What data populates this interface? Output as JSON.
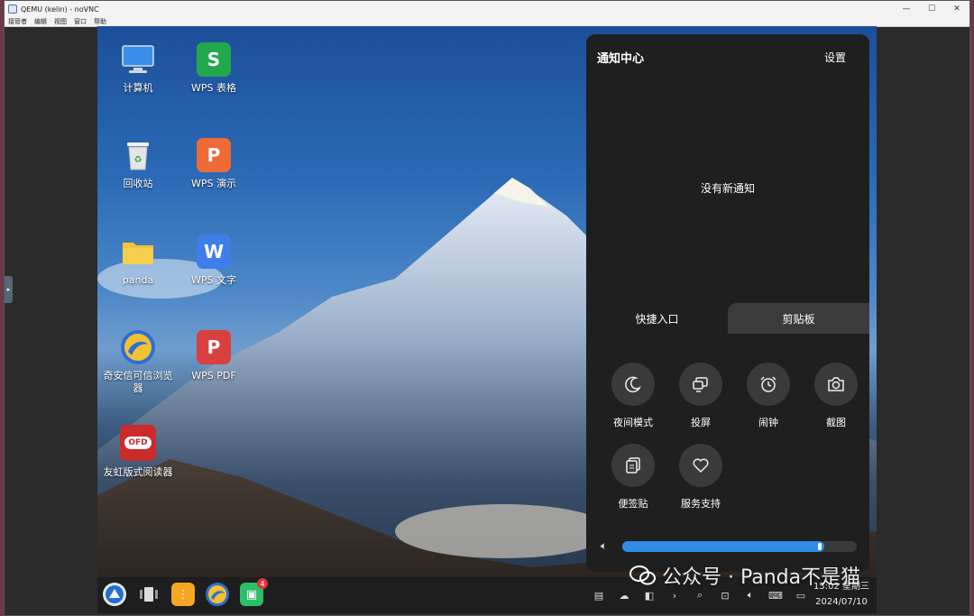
{
  "host": {
    "title": "QEMU (kelin) - noVNC",
    "menu": [
      "接管者",
      "编辑",
      "视图",
      "窗口",
      "帮助"
    ],
    "controls": [
      "—",
      "☐",
      "✕"
    ]
  },
  "desktop": {
    "icons": [
      {
        "name": "computer",
        "label": "计算机",
        "glyph": "monitor-icon",
        "color": "#3a8ee8"
      },
      {
        "name": "wps-sheets",
        "label": "WPS 表格",
        "glyph": "S",
        "color": "#22a84a"
      },
      {
        "name": "recycle-bin",
        "label": "回收站",
        "glyph": "trash-icon",
        "color": "#e9e9e9"
      },
      {
        "name": "wps-presentation",
        "label": "WPS 演示",
        "glyph": "P",
        "color": "#ee6a36"
      },
      {
        "name": "panda-folder",
        "label": "panda",
        "glyph": "folder-icon",
        "color": "#f3c238"
      },
      {
        "name": "wps-writer",
        "label": "WPS 文字",
        "glyph": "W",
        "color": "#3f7ee8"
      },
      {
        "name": "qianxin-browser",
        "label": "奇安信可信浏览器",
        "glyph": "browser-icon",
        "color": "#2d6ed6"
      },
      {
        "name": "wps-pdf",
        "label": "WPS PDF",
        "glyph": "P",
        "color": "#d94040"
      },
      {
        "name": "foxit-reader",
        "label": "友虹版式阅读器",
        "glyph": "OFD",
        "color": "#cc2b2b"
      }
    ]
  },
  "notification_center": {
    "title": "通知中心",
    "settings": "设置",
    "empty_text": "没有新通知",
    "tabs": [
      "快捷入口",
      "剪贴板"
    ],
    "quick_actions": [
      {
        "name": "night-mode",
        "label": "夜间模式",
        "icon": "moon-icon"
      },
      {
        "name": "screen-cast",
        "label": "投屏",
        "icon": "cast-icon"
      },
      {
        "name": "alarm",
        "label": "闹钟",
        "icon": "alarm-icon"
      },
      {
        "name": "screenshot",
        "label": "截图",
        "icon": "camera-icon"
      },
      {
        "name": "sticky-notes",
        "label": "便签贴",
        "icon": "notes-icon"
      },
      {
        "name": "service-support",
        "label": "服务支持",
        "icon": "heart-icon"
      }
    ],
    "volume_percent": 86
  },
  "taskbar": {
    "badge_count": "4",
    "clock_time": "15:02 星期三",
    "clock_date": "2024/07/10"
  },
  "watermark": {
    "text": "公众号 · Panda不是猫"
  }
}
